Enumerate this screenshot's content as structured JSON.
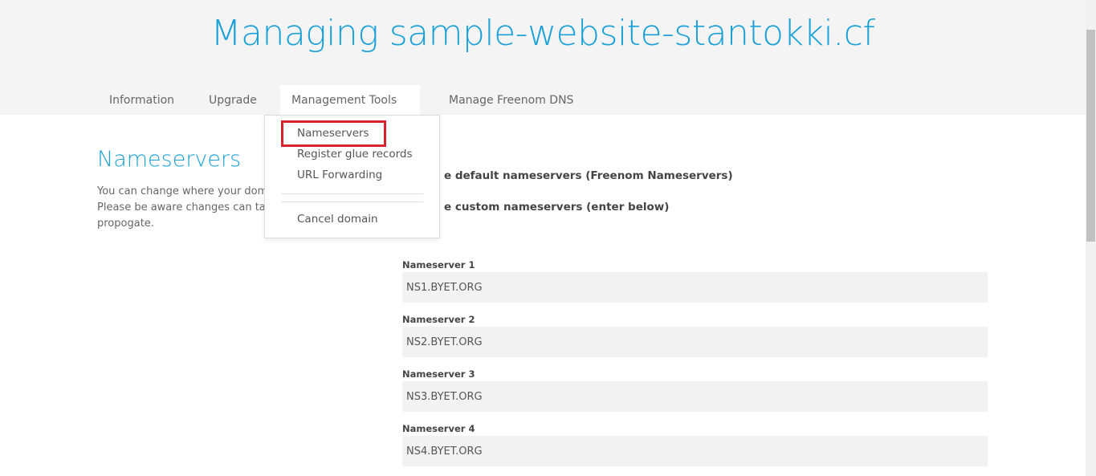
{
  "header": {
    "title": "Managing sample-website-stantokki.cf"
  },
  "nav": {
    "tabs": [
      {
        "label": "Information"
      },
      {
        "label": "Upgrade"
      },
      {
        "label": "Management Tools"
      },
      {
        "label": "Manage Freenom DNS"
      }
    ]
  },
  "dropdown": {
    "items": [
      {
        "label": "Nameservers"
      },
      {
        "label": "Register glue records"
      },
      {
        "label": "URL Forwarding"
      },
      {
        "label": "Cancel domain"
      }
    ]
  },
  "section": {
    "title": "Nameservers",
    "description_lines": [
      "You can change where your doma",
      "Please be aware changes can take",
      "propogate."
    ]
  },
  "options": {
    "default_label": "e default nameservers (Freenom Nameservers)",
    "custom_label": "e custom nameservers (enter below)"
  },
  "nameservers": [
    {
      "label": "Nameserver 1",
      "value": "NS1.BYET.ORG"
    },
    {
      "label": "Nameserver 2",
      "value": "NS2.BYET.ORG"
    },
    {
      "label": "Nameserver 3",
      "value": "NS3.BYET.ORG"
    },
    {
      "label": "Nameserver 4",
      "value": "NS4.BYET.ORG"
    }
  ],
  "colors": {
    "accent": "#1ba1d8",
    "highlight": "#d9232e",
    "header_bg": "#f4f4f4",
    "input_bg": "#f2f2f2"
  },
  "icons": {
    "caret": "caret-down-icon"
  }
}
